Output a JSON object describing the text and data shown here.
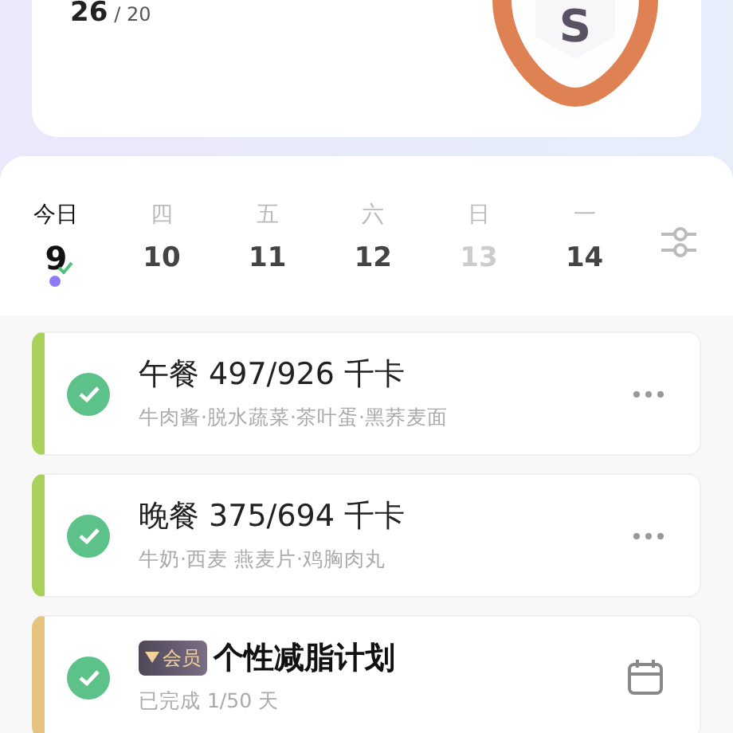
{
  "summary": {
    "value": "26",
    "total": "/ 20",
    "badge_letter": "S"
  },
  "week": {
    "days": [
      {
        "weekday": "今日",
        "date": "9",
        "selected": true,
        "dimmed": false,
        "done": true
      },
      {
        "weekday": "四",
        "date": "10",
        "selected": false,
        "dimmed": false,
        "done": false
      },
      {
        "weekday": "五",
        "date": "11",
        "selected": false,
        "dimmed": false,
        "done": false
      },
      {
        "weekday": "六",
        "date": "12",
        "selected": false,
        "dimmed": false,
        "done": false
      },
      {
        "weekday": "日",
        "date": "13",
        "selected": false,
        "dimmed": true,
        "done": false
      },
      {
        "weekday": "一",
        "date": "14",
        "selected": false,
        "dimmed": false,
        "done": false
      }
    ]
  },
  "entries": [
    {
      "kind": "meal",
      "title": "午餐 497/926 千卡",
      "detail": "牛肉酱·脱水蔬菜·茶叶蛋·黑荞麦面",
      "color": "#a9d25b",
      "checked": true
    },
    {
      "kind": "meal",
      "title": "晚餐 375/694 千卡",
      "detail": "牛奶·西麦 燕麦片·鸡胸肉丸",
      "color": "#a9d25b",
      "checked": true
    },
    {
      "kind": "plan",
      "tag": "会员",
      "title": "个性减脂计划",
      "detail": "已完成 1/50 天",
      "color": "#e6c47e",
      "checked": true
    }
  ]
}
